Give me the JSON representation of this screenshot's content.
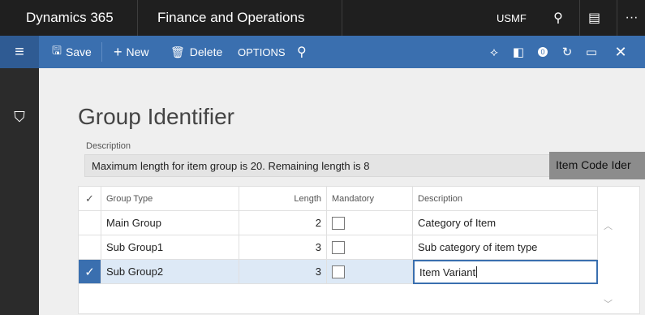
{
  "topbar": {
    "app_name": "Dynamics 365",
    "module": "Finance and Operations",
    "company": "USMF",
    "icons": [
      "search-icon",
      "chat-icon",
      "more-icon"
    ]
  },
  "commandbar": {
    "save": "Save",
    "new": "New",
    "delete": "Delete",
    "options": "OPTIONS",
    "notification_count": "0"
  },
  "page": {
    "title": "Group Identifier",
    "description_label": "Description",
    "description_value": "Maximum length for item group is 20. Remaining length is 8",
    "tooltip": "Item Code Ider"
  },
  "grid": {
    "headers": {
      "group_type": "Group Type",
      "length": "Length",
      "mandatory": "Mandatory",
      "description": "Description"
    },
    "rows": [
      {
        "group_type": "Main Group",
        "length": "2",
        "mandatory": false,
        "description": "Category of Item"
      },
      {
        "group_type": "Sub Group1",
        "length": "3",
        "mandatory": false,
        "description": "Sub category of item type"
      },
      {
        "group_type": "Sub Group2",
        "length": "3",
        "mandatory": false,
        "description": "Item Variant"
      }
    ],
    "selected_row": 2
  },
  "colors": {
    "accent": "#3a6faf",
    "topbar": "#1f1f1f",
    "selected_row": "#dde9f6"
  }
}
